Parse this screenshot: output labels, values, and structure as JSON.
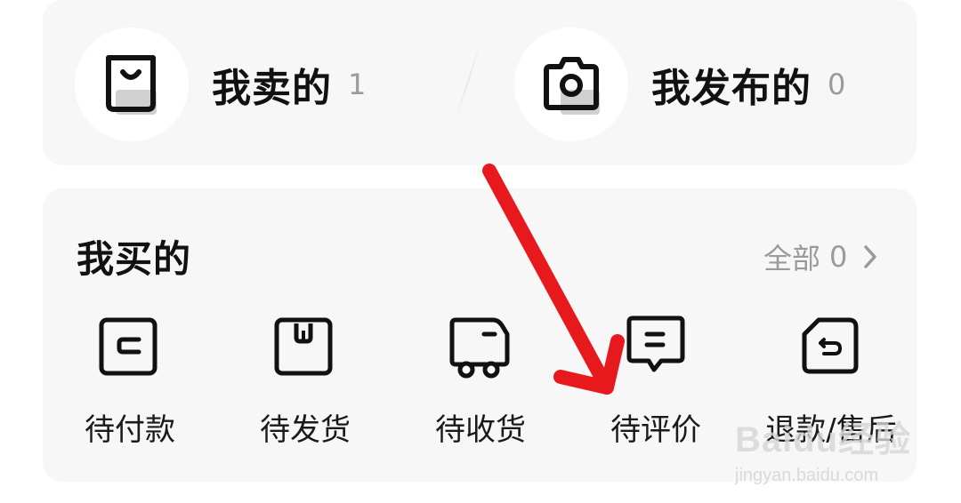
{
  "seller": {
    "sold": {
      "label": "我卖的",
      "count": "1",
      "icon": "shopping-bag-icon"
    },
    "published": {
      "label": "我发布的",
      "count": "0",
      "icon": "camera-icon"
    }
  },
  "bought": {
    "title": "我买的",
    "all_label": "全部",
    "all_count": "0",
    "items": [
      {
        "label": "待付款",
        "icon": "wallet-icon"
      },
      {
        "label": "待发货",
        "icon": "package-icon"
      },
      {
        "label": "待收货",
        "icon": "delivery-truck-icon"
      },
      {
        "label": "待评价",
        "icon": "comment-icon"
      },
      {
        "label": "退款/售后",
        "icon": "return-icon"
      }
    ]
  },
  "annotation": {
    "arrow_color": "#e8191d"
  },
  "watermark": {
    "main": "Baidu经验",
    "url": "jingyan.baidu.com"
  }
}
